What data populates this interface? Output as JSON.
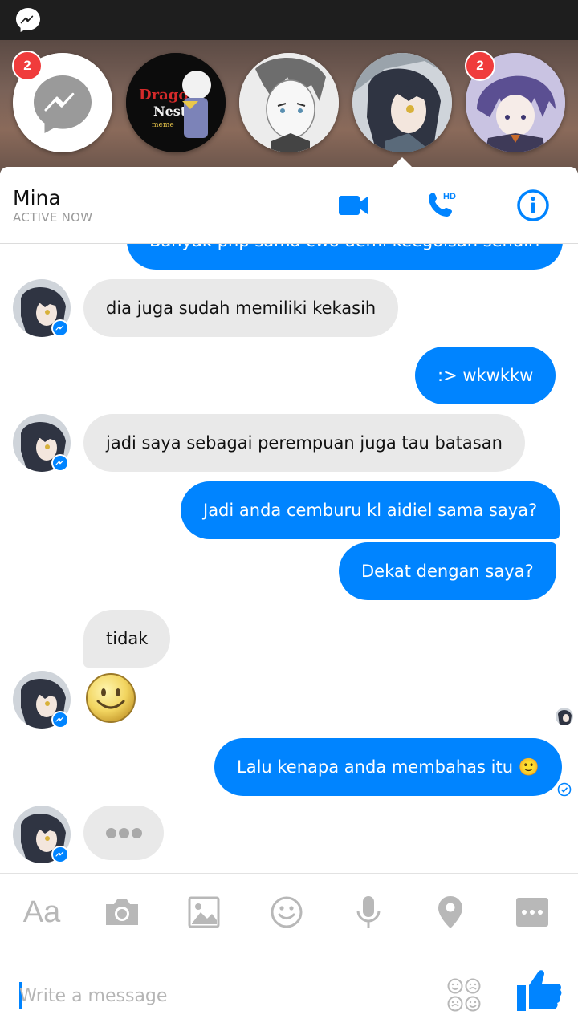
{
  "chat_heads": [
    {
      "name": "messenger-head",
      "badge": "2"
    },
    {
      "name": "dragon-nest-head",
      "badge": null
    },
    {
      "name": "manga-boy-head",
      "badge": null
    },
    {
      "name": "mina-head",
      "badge": null
    },
    {
      "name": "purple-hair-head",
      "badge": "2"
    }
  ],
  "header": {
    "contact_name": "Mina",
    "status": "ACTIVE NOW",
    "call_hd_label": "HD"
  },
  "messages": [
    {
      "side": "out",
      "text": "Banyak php sama cwo demi keegoisan sendiri"
    },
    {
      "side": "in",
      "text": "dia juga sudah memiliki kekasih"
    },
    {
      "side": "out",
      "text": ":> wkwkkw"
    },
    {
      "side": "in",
      "text": "jadi saya sebagai perempuan juga tau batasan"
    },
    {
      "side": "out",
      "text": "Jadi anda cemburu kl aidiel sama saya?"
    },
    {
      "side": "out",
      "text": "Dekat dengan saya?"
    },
    {
      "side": "in",
      "text": "tidak"
    },
    {
      "side": "in",
      "emoji": "smiley"
    },
    {
      "side": "out",
      "text": "Lalu kenapa anda membahas itu 🙂"
    }
  ],
  "toolbar": {
    "text_label": "Aa",
    "icons": [
      "camera-icon",
      "gallery-icon",
      "emoji-icon",
      "microphone-icon",
      "location-icon",
      "more-icon"
    ]
  },
  "composer": {
    "placeholder": "Write a message"
  },
  "colors": {
    "accent": "#0084ff",
    "incoming_bubble": "#e9e9e9",
    "badge": "#f03c3c"
  }
}
